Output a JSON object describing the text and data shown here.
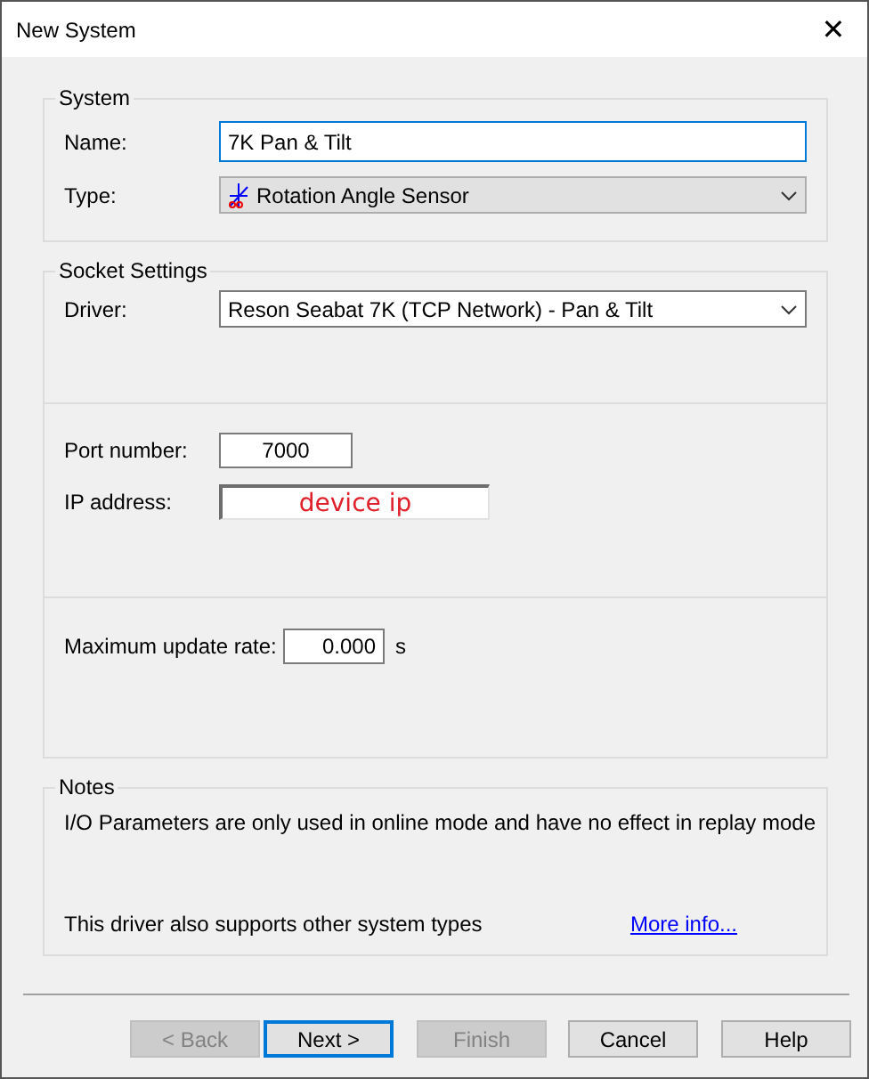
{
  "window": {
    "title": "New System",
    "close": "✕"
  },
  "system": {
    "title": "System",
    "name_label": "Name:",
    "name_value": "7K Pan & Tilt",
    "type_label": "Type:",
    "type_value": "Rotation Angle Sensor"
  },
  "socket": {
    "title": "Socket Settings",
    "driver_label": "Driver:",
    "driver_value": "Reson Seabat 7K (TCP Network) - Pan & Tilt",
    "port_label": "Port number:",
    "port_value": "7000",
    "ip_label": "IP address:",
    "ip_value": "device ip",
    "rate_label": "Maximum update rate:",
    "rate_value": "0.000",
    "rate_unit": "s"
  },
  "notes": {
    "title": "Notes",
    "text": "I/O Parameters are only used in online mode and have no effect in replay mode",
    "footer": "This driver also supports other system types",
    "link": "More info..."
  },
  "buttons": [
    {
      "label": "< Back",
      "disabled": true,
      "default": false
    },
    {
      "label": "Next >",
      "disabled": false,
      "default": true
    },
    {
      "label": "Finish",
      "disabled": true,
      "default": false
    },
    {
      "label": "Cancel",
      "disabled": false,
      "default": false
    },
    {
      "label": "Help",
      "disabled": false,
      "default": false
    }
  ]
}
